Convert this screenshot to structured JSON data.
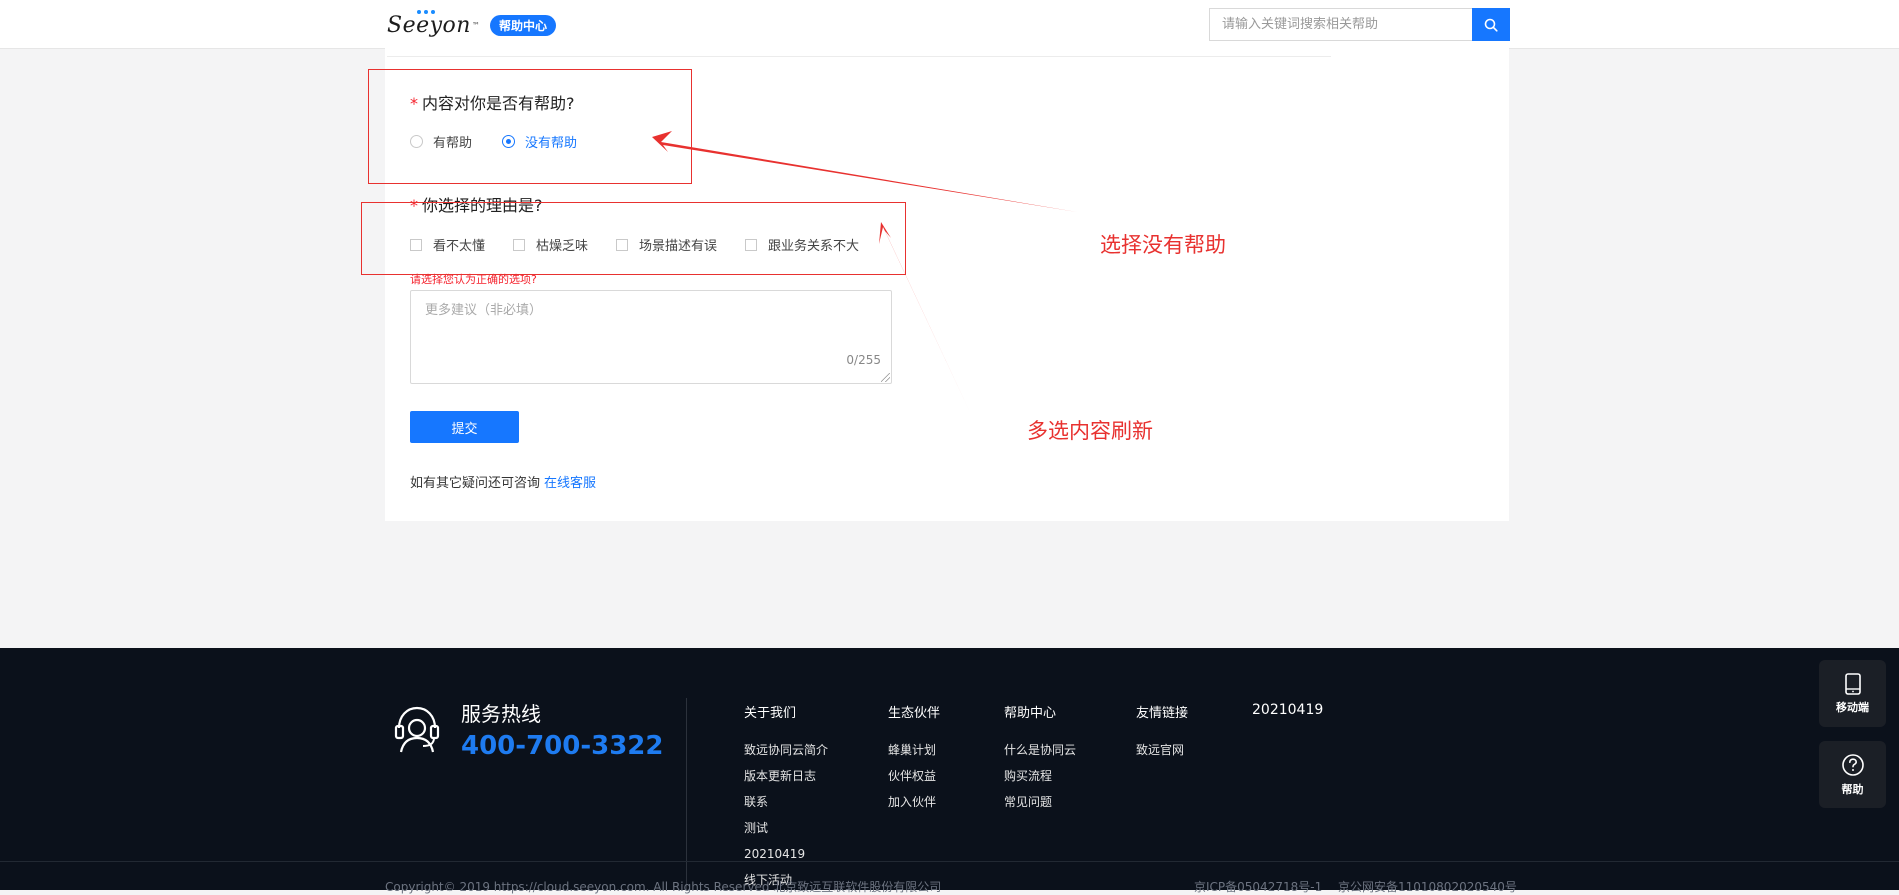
{
  "header": {
    "logo_text": "Seeyon",
    "logo_tm": "™",
    "badge": "帮助中心",
    "search_placeholder": "请输入关键词搜索相关帮助"
  },
  "feedback": {
    "q1": {
      "required_mark": "*",
      "label": "内容对你是否有帮助?",
      "options": [
        "有帮助",
        "没有帮助"
      ],
      "selected": "没有帮助"
    },
    "q2": {
      "required_mark": "*",
      "label": "你选择的理由是?",
      "options": [
        "看不太懂",
        "枯燥乏味",
        "场景描述有误",
        "跟业务关系不大"
      ],
      "error": "请选择您认为正确的选项?"
    },
    "textarea": {
      "placeholder": "更多建议（非必填）",
      "counter": "0/255"
    },
    "submit_label": "提交",
    "consult_text": "如有其它疑问还可咨询",
    "consult_link": "在线客服"
  },
  "annotations": {
    "note1": "选择没有帮助",
    "note2": "多选内容刷新",
    "color": "#e8312f"
  },
  "footer": {
    "hotline_title": "服务热线",
    "hotline_number": "400-700-3322",
    "columns": [
      {
        "title": "关于我们",
        "items": [
          "致远协同云简介",
          "版本更新日志",
          "联系",
          "测试",
          "20210419",
          "线下活动"
        ]
      },
      {
        "title": "生态伙伴",
        "items": [
          "蜂巢计划",
          "伙伴权益",
          "加入伙伴"
        ]
      },
      {
        "title": "帮助中心",
        "items": [
          "什么是协同云",
          "购买流程",
          "常见问题"
        ]
      },
      {
        "title": "友情链接",
        "items": [
          "致远官网"
        ]
      },
      {
        "title": "20210419",
        "items": []
      }
    ],
    "copyright": "Copyright© 2019 https://cloud.seeyon.com. All Rights Reserved 北京致远互联软件股份有限公司",
    "icp": "京ICP备05042718号-1",
    "police": "京公网安备11010802020540号"
  },
  "float_buttons": {
    "mobile": "移动端",
    "help": "帮助"
  },
  "colors": {
    "accent": "#1677ff",
    "footer_bg": "#0b111b",
    "required": "#f5222d"
  }
}
